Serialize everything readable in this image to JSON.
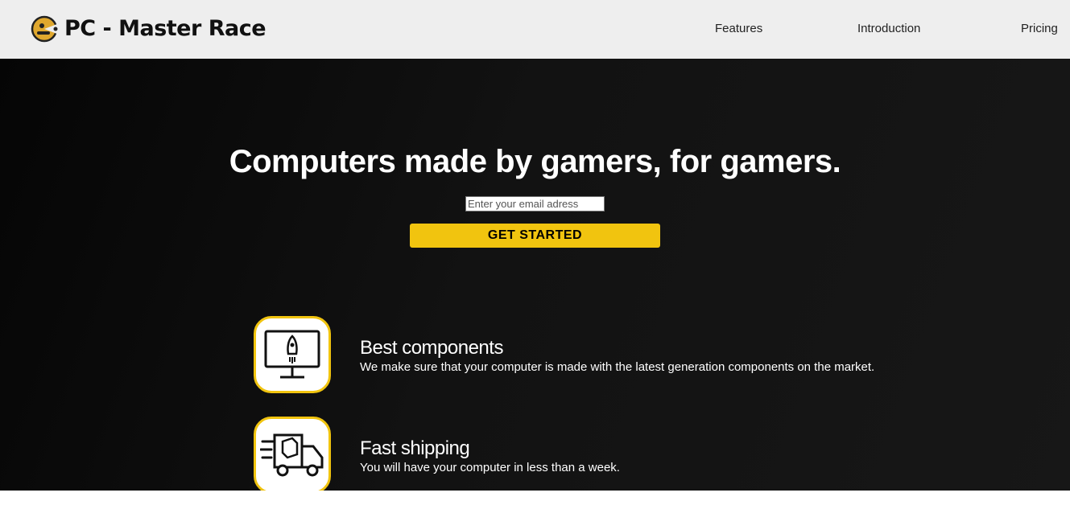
{
  "brand": {
    "name": "PC - Master Race",
    "icon": "gamer-logo-icon"
  },
  "nav": [
    {
      "label": "Features"
    },
    {
      "label": "Introduction"
    },
    {
      "label": "Pricing"
    }
  ],
  "hero": {
    "title": "Computers made by gamers, for gamers.",
    "email_placeholder": "Enter your email adress",
    "button_label": "GET STARTED"
  },
  "features": [
    {
      "icon": "monitor-rocket-icon",
      "heading": "Best components",
      "text": "We make sure that your computer is made with the latest generation components on the market."
    },
    {
      "icon": "delivery-truck-icon",
      "heading": "Fast shipping",
      "text": "You will have your computer in less than a week."
    }
  ],
  "colors": {
    "accent": "#f1c40f",
    "navbar": "#eeeeee",
    "hero_dark": "#0a0a0a"
  }
}
